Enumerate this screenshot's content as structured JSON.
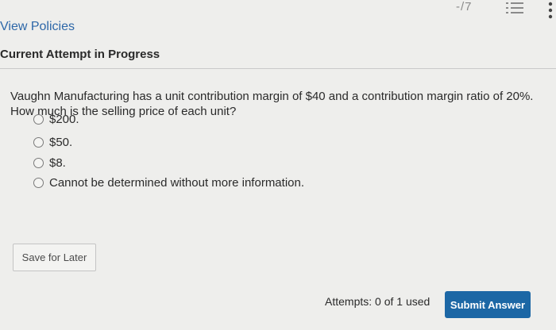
{
  "header": {
    "score_text": "-/7",
    "list_icon": "numbered-list-icon",
    "more_icon": "more-vertical-icon"
  },
  "links": {
    "view_policies": "View Policies"
  },
  "attempt": {
    "title": "Current Attempt in Progress"
  },
  "question": {
    "text": "Vaughn Manufacturing has a unit contribution margin of $40 and a contribution margin ratio of 20%. How much is the selling price of each unit?",
    "options": [
      {
        "label": "$200."
      },
      {
        "label": "$50."
      },
      {
        "label": "$8."
      },
      {
        "label": "Cannot be determined without more information."
      }
    ]
  },
  "actions": {
    "save_label": "Save for Later",
    "attempts_text": "Attempts: 0 of 1 used",
    "submit_label": "Submit Answer"
  },
  "colors": {
    "link": "#2d67a8",
    "submit_bg": "#1c67a5",
    "page_bg": "#eeeeec"
  }
}
